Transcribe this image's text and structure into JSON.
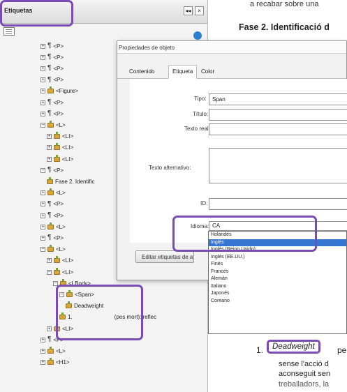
{
  "panel": {
    "title": "Etiquetas",
    "header_buttons": [
      "◂◂",
      "×"
    ]
  },
  "tree": [
    {
      "indent": 1,
      "expander": "+",
      "icon": "paragraph",
      "label": "<P>"
    },
    {
      "indent": 1,
      "expander": "+",
      "icon": "paragraph",
      "label": "<P>"
    },
    {
      "indent": 1,
      "expander": "+",
      "icon": "paragraph",
      "label": "<P>"
    },
    {
      "indent": 1,
      "expander": "+",
      "icon": "paragraph",
      "label": "<P>"
    },
    {
      "indent": 1,
      "expander": "+",
      "icon": "tag",
      "label": "<Figure>"
    },
    {
      "indent": 1,
      "expander": "+",
      "icon": "paragraph",
      "label": "<P>"
    },
    {
      "indent": 1,
      "expander": "+",
      "icon": "paragraph",
      "label": "<P>"
    },
    {
      "indent": 1,
      "expander": "−",
      "icon": "tag",
      "label": "<L>"
    },
    {
      "indent": 2,
      "expander": "+",
      "icon": "tag",
      "label": "<LI>"
    },
    {
      "indent": 2,
      "expander": "+",
      "icon": "tag",
      "label": "<LI>"
    },
    {
      "indent": 2,
      "expander": "+",
      "icon": "tag",
      "label": "<LI>"
    },
    {
      "indent": 1,
      "expander": "−",
      "icon": "paragraph",
      "label": "<P>"
    },
    {
      "indent": 2,
      "expander": "",
      "icon": "tag",
      "label": "Fase 2. Identific"
    },
    {
      "indent": 1,
      "expander": "+",
      "icon": "tag",
      "label": "<L>"
    },
    {
      "indent": 1,
      "expander": "+",
      "icon": "paragraph",
      "label": "<P>"
    },
    {
      "indent": 1,
      "expander": "+",
      "icon": "paragraph",
      "label": "<P>"
    },
    {
      "indent": 1,
      "expander": "+",
      "icon": "tag",
      "label": "<L>"
    },
    {
      "indent": 1,
      "expander": "+",
      "icon": "paragraph",
      "label": "<P>"
    },
    {
      "indent": 1,
      "expander": "−",
      "icon": "tag",
      "label": "<L>"
    },
    {
      "indent": 2,
      "expander": "+",
      "icon": "tag",
      "label": "<LI>"
    },
    {
      "indent": 2,
      "expander": "−",
      "icon": "tag",
      "label": "<LI>"
    },
    {
      "indent": 3,
      "expander": "−",
      "icon": "tag",
      "label": "<LBody>"
    },
    {
      "indent": 4,
      "expander": "−",
      "icon": "tag",
      "label": "<Span>"
    },
    {
      "indent": 5,
      "expander": "",
      "icon": "tag",
      "label": "Deadweight"
    },
    {
      "indent": 4,
      "expander": "",
      "icon": "tag",
      "label": "1.",
      "extra": "(pes mort): reflec"
    },
    {
      "indent": 2,
      "expander": "+",
      "icon": "tag",
      "label": "<LI>"
    },
    {
      "indent": 1,
      "expander": "+",
      "icon": "paragraph",
      "label": "<P>"
    },
    {
      "indent": 1,
      "expander": "+",
      "icon": "tag",
      "label": "<L>"
    },
    {
      "indent": 1,
      "expander": "+",
      "icon": "tag",
      "label": "<H1>"
    }
  ],
  "document": {
    "top_line": "a recabar sobre una",
    "heading": "Fase 2. Identificació d",
    "list_number": "1.",
    "term": "Deadweight",
    "term_after": "pe",
    "lines": [
      "sense l'acció d",
      "aconseguit sen",
      "treballadors, la"
    ]
  },
  "dialog": {
    "title": "Propiedades de objeto",
    "tabs": [
      "Contenido",
      "Etiqueta",
      "Color"
    ],
    "active_tab": "Etiqueta",
    "tipo_label": "Tipo:",
    "tipo_value": "Span",
    "titulo_label": "Título:",
    "titulo_value": "",
    "texto_real_label": "Texto real:",
    "texto_real_value": "",
    "texto_alt_label": "Texto alternativo:",
    "texto_alt_value": "",
    "id_label": "ID:",
    "id_value": "",
    "idioma_label": "Idioma:",
    "idioma_value": "CA",
    "edit_button": "Editar etiquetas de atributo..."
  },
  "language_options": [
    {
      "label": "Holandés",
      "selected": false
    },
    {
      "label": "Inglés",
      "selected": true
    },
    {
      "label": "Inglés (Reino Unido)",
      "selected": false
    },
    {
      "label": "Inglés (EE.UU.)",
      "selected": false
    },
    {
      "label": "Finés",
      "selected": false
    },
    {
      "label": "Francés",
      "selected": false
    },
    {
      "label": "Alemán",
      "selected": false
    },
    {
      "label": "Italiano",
      "selected": false
    },
    {
      "label": "Japonés",
      "selected": false
    },
    {
      "label": "Coreano",
      "selected": false
    }
  ],
  "colors": {
    "highlight": "#7a4bb5",
    "selection": "#3476d2",
    "tag_icon": "#d6a63b"
  }
}
